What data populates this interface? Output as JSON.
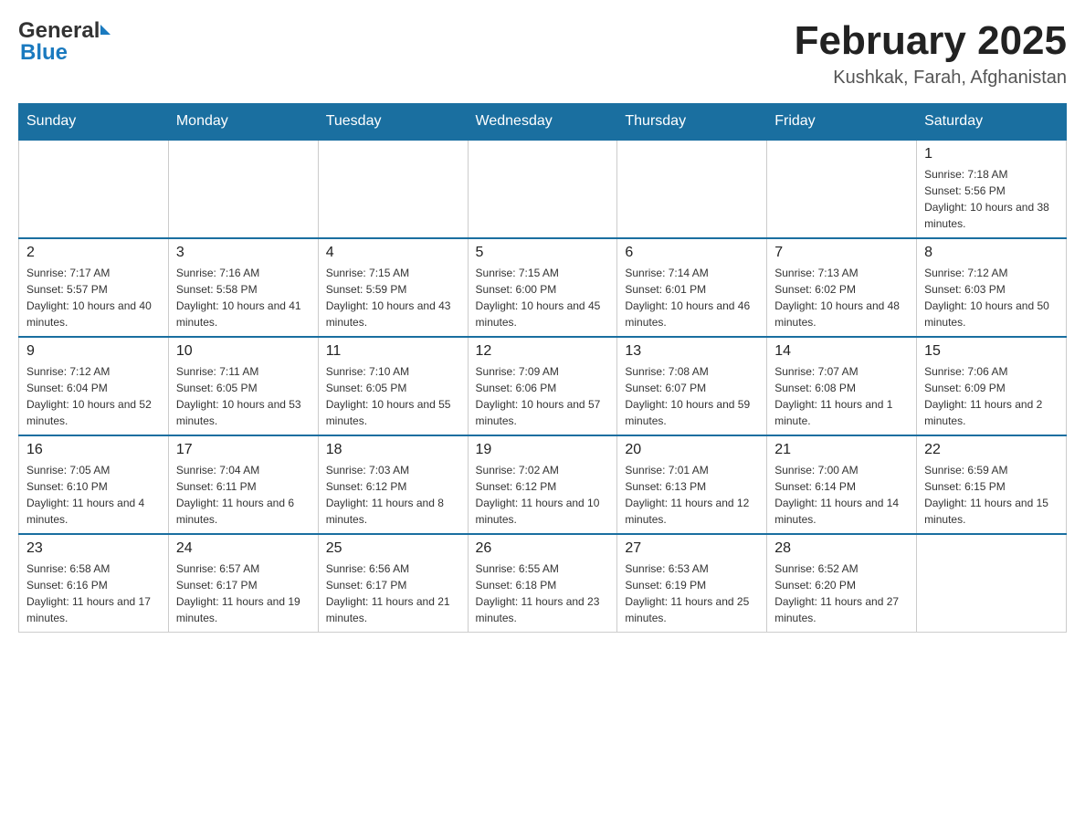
{
  "header": {
    "logo_general": "General",
    "logo_blue": "Blue",
    "month_title": "February 2025",
    "location": "Kushkak, Farah, Afghanistan"
  },
  "weekdays": [
    "Sunday",
    "Monday",
    "Tuesday",
    "Wednesday",
    "Thursday",
    "Friday",
    "Saturday"
  ],
  "weeks": [
    [
      {
        "day": "",
        "sunrise": "",
        "sunset": "",
        "daylight": ""
      },
      {
        "day": "",
        "sunrise": "",
        "sunset": "",
        "daylight": ""
      },
      {
        "day": "",
        "sunrise": "",
        "sunset": "",
        "daylight": ""
      },
      {
        "day": "",
        "sunrise": "",
        "sunset": "",
        "daylight": ""
      },
      {
        "day": "",
        "sunrise": "",
        "sunset": "",
        "daylight": ""
      },
      {
        "day": "",
        "sunrise": "",
        "sunset": "",
        "daylight": ""
      },
      {
        "day": "1",
        "sunrise": "Sunrise: 7:18 AM",
        "sunset": "Sunset: 5:56 PM",
        "daylight": "Daylight: 10 hours and 38 minutes."
      }
    ],
    [
      {
        "day": "2",
        "sunrise": "Sunrise: 7:17 AM",
        "sunset": "Sunset: 5:57 PM",
        "daylight": "Daylight: 10 hours and 40 minutes."
      },
      {
        "day": "3",
        "sunrise": "Sunrise: 7:16 AM",
        "sunset": "Sunset: 5:58 PM",
        "daylight": "Daylight: 10 hours and 41 minutes."
      },
      {
        "day": "4",
        "sunrise": "Sunrise: 7:15 AM",
        "sunset": "Sunset: 5:59 PM",
        "daylight": "Daylight: 10 hours and 43 minutes."
      },
      {
        "day": "5",
        "sunrise": "Sunrise: 7:15 AM",
        "sunset": "Sunset: 6:00 PM",
        "daylight": "Daylight: 10 hours and 45 minutes."
      },
      {
        "day": "6",
        "sunrise": "Sunrise: 7:14 AM",
        "sunset": "Sunset: 6:01 PM",
        "daylight": "Daylight: 10 hours and 46 minutes."
      },
      {
        "day": "7",
        "sunrise": "Sunrise: 7:13 AM",
        "sunset": "Sunset: 6:02 PM",
        "daylight": "Daylight: 10 hours and 48 minutes."
      },
      {
        "day": "8",
        "sunrise": "Sunrise: 7:12 AM",
        "sunset": "Sunset: 6:03 PM",
        "daylight": "Daylight: 10 hours and 50 minutes."
      }
    ],
    [
      {
        "day": "9",
        "sunrise": "Sunrise: 7:12 AM",
        "sunset": "Sunset: 6:04 PM",
        "daylight": "Daylight: 10 hours and 52 minutes."
      },
      {
        "day": "10",
        "sunrise": "Sunrise: 7:11 AM",
        "sunset": "Sunset: 6:05 PM",
        "daylight": "Daylight: 10 hours and 53 minutes."
      },
      {
        "day": "11",
        "sunrise": "Sunrise: 7:10 AM",
        "sunset": "Sunset: 6:05 PM",
        "daylight": "Daylight: 10 hours and 55 minutes."
      },
      {
        "day": "12",
        "sunrise": "Sunrise: 7:09 AM",
        "sunset": "Sunset: 6:06 PM",
        "daylight": "Daylight: 10 hours and 57 minutes."
      },
      {
        "day": "13",
        "sunrise": "Sunrise: 7:08 AM",
        "sunset": "Sunset: 6:07 PM",
        "daylight": "Daylight: 10 hours and 59 minutes."
      },
      {
        "day": "14",
        "sunrise": "Sunrise: 7:07 AM",
        "sunset": "Sunset: 6:08 PM",
        "daylight": "Daylight: 11 hours and 1 minute."
      },
      {
        "day": "15",
        "sunrise": "Sunrise: 7:06 AM",
        "sunset": "Sunset: 6:09 PM",
        "daylight": "Daylight: 11 hours and 2 minutes."
      }
    ],
    [
      {
        "day": "16",
        "sunrise": "Sunrise: 7:05 AM",
        "sunset": "Sunset: 6:10 PM",
        "daylight": "Daylight: 11 hours and 4 minutes."
      },
      {
        "day": "17",
        "sunrise": "Sunrise: 7:04 AM",
        "sunset": "Sunset: 6:11 PM",
        "daylight": "Daylight: 11 hours and 6 minutes."
      },
      {
        "day": "18",
        "sunrise": "Sunrise: 7:03 AM",
        "sunset": "Sunset: 6:12 PM",
        "daylight": "Daylight: 11 hours and 8 minutes."
      },
      {
        "day": "19",
        "sunrise": "Sunrise: 7:02 AM",
        "sunset": "Sunset: 6:12 PM",
        "daylight": "Daylight: 11 hours and 10 minutes."
      },
      {
        "day": "20",
        "sunrise": "Sunrise: 7:01 AM",
        "sunset": "Sunset: 6:13 PM",
        "daylight": "Daylight: 11 hours and 12 minutes."
      },
      {
        "day": "21",
        "sunrise": "Sunrise: 7:00 AM",
        "sunset": "Sunset: 6:14 PM",
        "daylight": "Daylight: 11 hours and 14 minutes."
      },
      {
        "day": "22",
        "sunrise": "Sunrise: 6:59 AM",
        "sunset": "Sunset: 6:15 PM",
        "daylight": "Daylight: 11 hours and 15 minutes."
      }
    ],
    [
      {
        "day": "23",
        "sunrise": "Sunrise: 6:58 AM",
        "sunset": "Sunset: 6:16 PM",
        "daylight": "Daylight: 11 hours and 17 minutes."
      },
      {
        "day": "24",
        "sunrise": "Sunrise: 6:57 AM",
        "sunset": "Sunset: 6:17 PM",
        "daylight": "Daylight: 11 hours and 19 minutes."
      },
      {
        "day": "25",
        "sunrise": "Sunrise: 6:56 AM",
        "sunset": "Sunset: 6:17 PM",
        "daylight": "Daylight: 11 hours and 21 minutes."
      },
      {
        "day": "26",
        "sunrise": "Sunrise: 6:55 AM",
        "sunset": "Sunset: 6:18 PM",
        "daylight": "Daylight: 11 hours and 23 minutes."
      },
      {
        "day": "27",
        "sunrise": "Sunrise: 6:53 AM",
        "sunset": "Sunset: 6:19 PM",
        "daylight": "Daylight: 11 hours and 25 minutes."
      },
      {
        "day": "28",
        "sunrise": "Sunrise: 6:52 AM",
        "sunset": "Sunset: 6:20 PM",
        "daylight": "Daylight: 11 hours and 27 minutes."
      },
      {
        "day": "",
        "sunrise": "",
        "sunset": "",
        "daylight": ""
      }
    ]
  ]
}
